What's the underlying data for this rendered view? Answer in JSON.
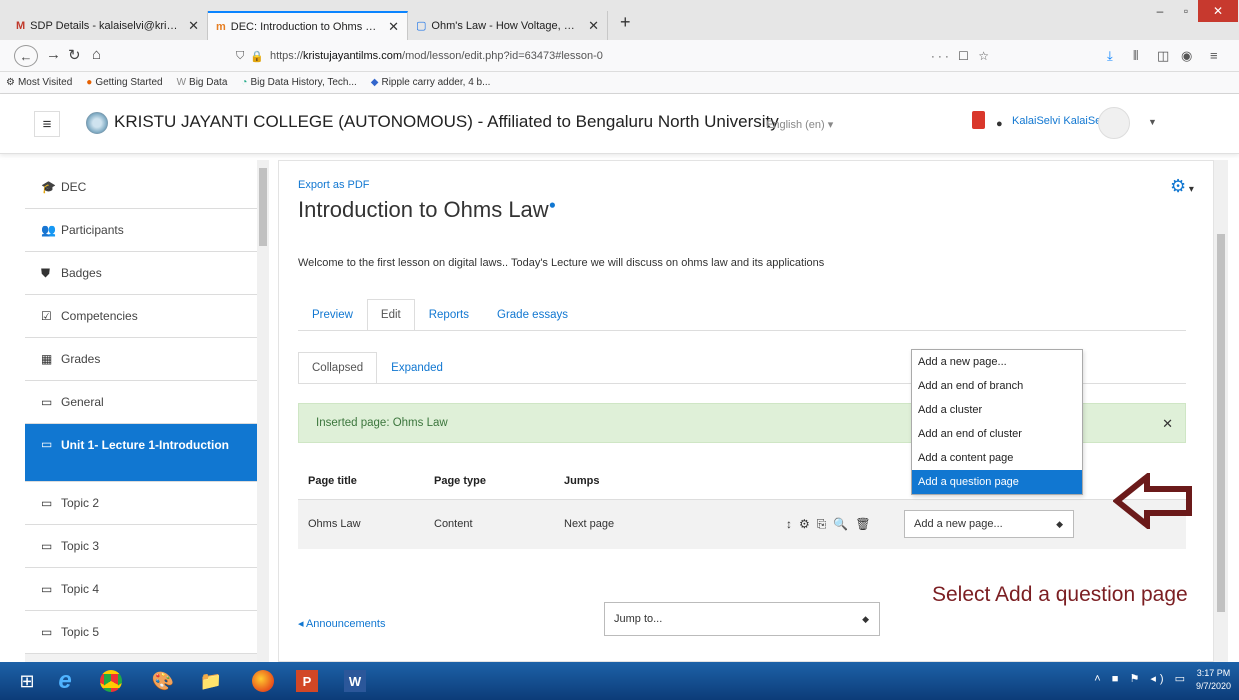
{
  "browser": {
    "tabs": [
      {
        "favicon": "M",
        "title": "SDP Details - kalaiselvi@kristuj",
        "active": false
      },
      {
        "favicon": "m",
        "title": "DEC: Introduction to Ohms Law",
        "active": true
      },
      {
        "favicon": "▢",
        "title": "Ohm's Law - How Voltage, Curr",
        "active": false
      }
    ],
    "new_tab": "+",
    "url_prefix": "https://",
    "url_host": "kristujayantilms.com",
    "url_path": "/mod/lesson/edit.php?id=63473#lesson-0",
    "url_actions": "··· ☐ ☆",
    "bookmarks": [
      {
        "icon": "⚙",
        "label": "Most Visited"
      },
      {
        "icon": "●",
        "label": "Getting Started"
      },
      {
        "icon": "W",
        "label": "Big Data"
      },
      {
        "icon": "◔",
        "label": "Big Data History, Tech..."
      },
      {
        "icon": "◆",
        "label": "Ripple carry adder, 4 b..."
      }
    ]
  },
  "header": {
    "site_name": "KRISTU JAYANTI COLLEGE (AUTONOMOUS) - Affiliated to Bengaluru North University",
    "language": "English (en) ▾",
    "user_name": "KalaiSelvi KalaiSelvi"
  },
  "sidebar": {
    "items": [
      {
        "icon": "🎓",
        "label": "DEC",
        "name": "sidebar-item-dec"
      },
      {
        "icon": "👥",
        "label": "Participants",
        "name": "sidebar-item-participants"
      },
      {
        "icon": "⛊",
        "label": "Badges",
        "name": "sidebar-item-badges"
      },
      {
        "icon": "☑",
        "label": "Competencies",
        "name": "sidebar-item-competencies"
      },
      {
        "icon": "▦",
        "label": "Grades",
        "name": "sidebar-item-grades"
      },
      {
        "icon": "▭",
        "label": "General",
        "name": "sidebar-item-general"
      },
      {
        "icon": "▭",
        "label": "Unit 1- Lecture 1-Introduction",
        "name": "sidebar-item-unit1",
        "active": true
      },
      {
        "icon": "▭",
        "label": "Topic 2",
        "name": "sidebar-item-topic2"
      },
      {
        "icon": "▭",
        "label": "Topic 3",
        "name": "sidebar-item-topic3"
      },
      {
        "icon": "▭",
        "label": "Topic 4",
        "name": "sidebar-item-topic4"
      },
      {
        "icon": "▭",
        "label": "Topic 5",
        "name": "sidebar-item-topic5"
      }
    ]
  },
  "main": {
    "export_pdf": "Export as PDF",
    "title": "Introduction to Ohms Law",
    "intro": "Welcome to the first lesson on digital laws.. Today's Lecture we will discuss on ohms law and its applications",
    "tabs": [
      {
        "label": "Preview",
        "active": false
      },
      {
        "label": "Edit",
        "active": true
      },
      {
        "label": "Reports",
        "active": false
      },
      {
        "label": "Grade essays",
        "active": false
      }
    ],
    "view_tabs": [
      {
        "label": "Collapsed",
        "active": true
      },
      {
        "label": "Expanded",
        "active": false
      }
    ],
    "alert": "Inserted page: Ohms Law",
    "table": {
      "headers": [
        "Page title",
        "Page type",
        "Jumps"
      ],
      "rows": [
        {
          "title": "Ohms Law",
          "type": "Content",
          "jumps": "Next page",
          "select_value": "Add a new page..."
        }
      ]
    },
    "dropdown_options": [
      "Add a new page...",
      "Add an end of branch",
      "Add a cluster",
      "Add an end of cluster",
      "Add a content page",
      "Add a question page"
    ],
    "dropdown_selected_index": 5,
    "announcements": "◂ Announcements",
    "jump_to": "Jump to..."
  },
  "annotation": "Select Add a question page",
  "taskbar": {
    "clock_time": "3:17 PM",
    "clock_date": "9/7/2020"
  }
}
